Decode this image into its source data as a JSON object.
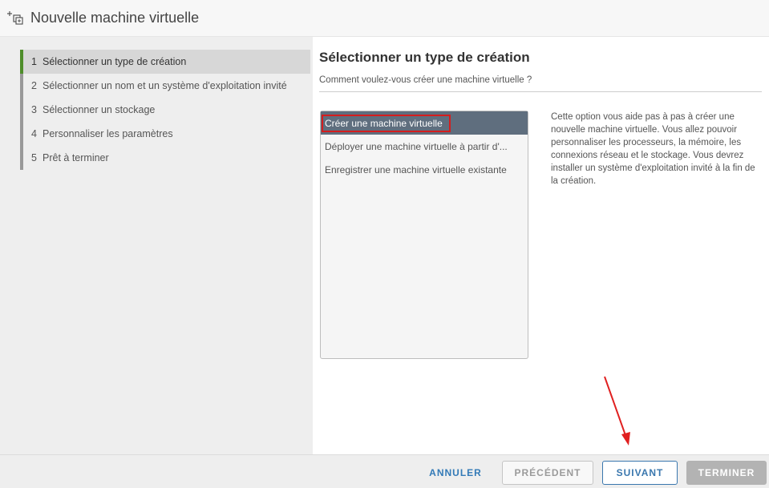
{
  "window": {
    "title": "Nouvelle machine virtuelle",
    "icon": "new-vm-icon"
  },
  "steps": [
    {
      "number": "1",
      "label": "Sélectionner un type de création",
      "active": true
    },
    {
      "number": "2",
      "label": "Sélectionner un nom et un système d'exploitation invité",
      "active": false
    },
    {
      "number": "3",
      "label": "Sélectionner un stockage",
      "active": false
    },
    {
      "number": "4",
      "label": "Personnaliser les paramètres",
      "active": false
    },
    {
      "number": "5",
      "label": "Prêt à terminer",
      "active": false
    }
  ],
  "page": {
    "title": "Sélectionner un type de création",
    "subtitle": "Comment voulez-vous créer une machine virtuelle ?"
  },
  "creation_types": [
    {
      "label": "Créer une machine virtuelle",
      "selected": true
    },
    {
      "label": "Déployer une machine virtuelle à partir d'...",
      "selected": false
    },
    {
      "label": "Enregistrer une machine virtuelle existante",
      "selected": false
    }
  ],
  "description": "Cette option vous aide pas à pas à créer une nouvelle machine virtuelle. Vous allez pouvoir personnaliser les processeurs, la mémoire, les connexions réseau et le stockage. Vous devrez installer un système d'exploitation invité à la fin de la création.",
  "footer": {
    "cancel_label": "ANNULER",
    "previous_label": "PRÉCÉDENT",
    "next_label": "SUIVANT",
    "finish_label": "TERMINER"
  },
  "colors": {
    "active_step_accent": "#4e8d2a",
    "selected_item_bg": "#5f6e7e",
    "highlight_box": "#d51d1d",
    "arrow": "#e02020",
    "link_blue": "#337ab7"
  }
}
